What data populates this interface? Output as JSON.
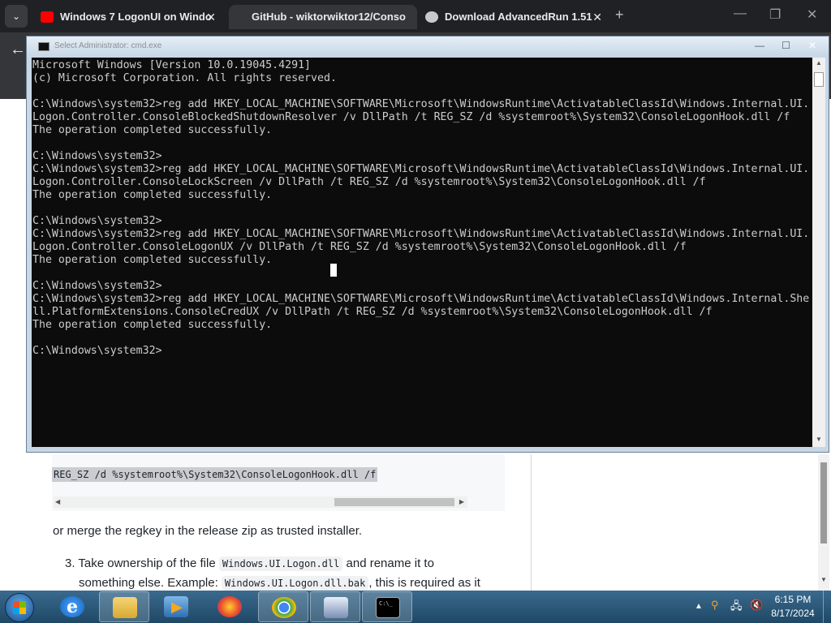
{
  "browser": {
    "tabs": [
      {
        "title": "Windows 7 LogonUI on Windo",
        "icon": "youtube-icon",
        "active": false
      },
      {
        "title": "GitHub - wiktorwiktor12/Conso",
        "icon": "github-icon",
        "active": true
      },
      {
        "title": "Download AdvancedRun 1.51",
        "icon": "nirsoft-icon",
        "active": false
      }
    ],
    "new_tab": "+",
    "close_glyph": "✕",
    "back_glyph": "←",
    "tab_dropdown": "⌄",
    "window_controls": {
      "minimize": "—",
      "maximize": "❐",
      "close": "✕"
    }
  },
  "page": {
    "code_line": "REG_SZ /d %systemroot%\\System32\\ConsoleLogonHook.dll /f",
    "paragraph": "or merge the regkey in the release zip as trusted installer.",
    "list_item_3": {
      "prefix": "3. Take ownership of the file ",
      "code1": "Windows.UI.Logon.dll",
      "mid": " and rename it to",
      "line2_prefix": "something else. Example: ",
      "code2": "Windows.UI.Logon.dll.bak",
      "line2_suffix": ", this is required as it"
    },
    "scroll_left": "◀",
    "scroll_right": "▶"
  },
  "console": {
    "title": "Select Administrator: cmd.exe",
    "buttons": {
      "minimize": "—",
      "maximize": "☐",
      "close": "✕"
    },
    "output": "Microsoft Windows [Version 10.0.19045.4291]\n(c) Microsoft Corporation. All rights reserved.\n\nC:\\Windows\\system32>reg add HKEY_LOCAL_MACHINE\\SOFTWARE\\Microsoft\\WindowsRuntime\\ActivatableClassId\\Windows.Internal.UI.\nLogon.Controller.ConsoleBlockedShutdownResolver /v DllPath /t REG_SZ /d %systemroot%\\System32\\ConsoleLogonHook.dll /f\nThe operation completed successfully.\n\nC:\\Windows\\system32>\nC:\\Windows\\system32>reg add HKEY_LOCAL_MACHINE\\SOFTWARE\\Microsoft\\WindowsRuntime\\ActivatableClassId\\Windows.Internal.UI.\nLogon.Controller.ConsoleLockScreen /v DllPath /t REG_SZ /d %systemroot%\\System32\\ConsoleLogonHook.dll /f\nThe operation completed successfully.\n\nC:\\Windows\\system32>\nC:\\Windows\\system32>reg add HKEY_LOCAL_MACHINE\\SOFTWARE\\Microsoft\\WindowsRuntime\\ActivatableClassId\\Windows.Internal.UI.\nLogon.Controller.ConsoleLogonUX /v DllPath /t REG_SZ /d %systemroot%\\System32\\ConsoleLogonHook.dll /f\nThe operation completed successfully.\n\nC:\\Windows\\system32>\nC:\\Windows\\system32>reg add HKEY_LOCAL_MACHINE\\SOFTWARE\\Microsoft\\WindowsRuntime\\ActivatableClassId\\Windows.Internal.She\nll.PlatformExtensions.ConsoleCredUX /v DllPath /t REG_SZ /d %systemroot%\\System32\\ConsoleLogonHook.dll /f\nThe operation completed successfully.\n\nC:\\Windows\\system32>",
    "scroll_up": "▲",
    "scroll_down": "▼",
    "colors": {
      "background": "#0c0c0c",
      "text": "#cccccc"
    }
  },
  "taskbar": {
    "items": [
      {
        "name": "internet-explorer",
        "icon": "ie-icon",
        "glyph": "e"
      },
      {
        "name": "windows-explorer",
        "icon": "folder-icon"
      },
      {
        "name": "media-player",
        "icon": "media-icon",
        "glyph": "▶"
      },
      {
        "name": "firefox",
        "icon": "firefox-icon"
      },
      {
        "name": "chrome",
        "icon": "chrome-icon"
      },
      {
        "name": "app",
        "icon": "app-window-icon"
      },
      {
        "name": "cmd",
        "icon": "cmd-icon",
        "glyph": "C:\\_"
      }
    ],
    "tray": {
      "expand": "▲",
      "search": "⚲",
      "network": "🖧",
      "volume": "🔇"
    },
    "time": "6:15 PM",
    "date": "8/17/2024"
  }
}
